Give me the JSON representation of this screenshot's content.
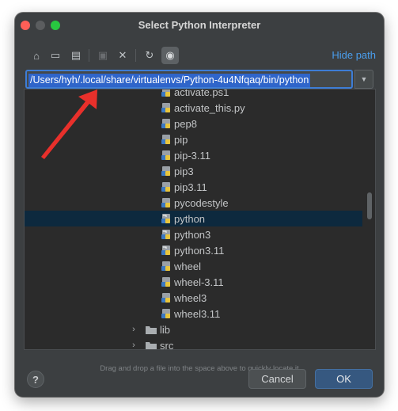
{
  "window": {
    "title": "Select Python Interpreter",
    "traffic_colors": {
      "close": "#ff5f57",
      "minimize": "#5b5d5f",
      "maximize": "#28c840"
    }
  },
  "toolbar": {
    "buttons": [
      {
        "icon": "home-icon",
        "glyph": "⌂"
      },
      {
        "icon": "desktop-icon",
        "glyph": "▭"
      },
      {
        "icon": "project-folder-icon",
        "glyph": "▤"
      },
      {
        "icon": "new-folder-icon",
        "glyph": "▣"
      },
      {
        "icon": "delete-icon",
        "glyph": "✕"
      },
      {
        "icon": "refresh-icon",
        "glyph": "↻"
      },
      {
        "icon": "show-hidden-files-icon",
        "glyph": "◉"
      }
    ],
    "hide_path_label": "Hide path"
  },
  "path_field": {
    "value": "/Users/hyh/.local/share/virtualenvs/Python-4u4Nfqaq/bin/python"
  },
  "tree": {
    "python_files": [
      "activate.ps1",
      "activate_this.py",
      "pep8",
      "pip",
      "pip-3.11",
      "pip3",
      "pip3.11",
      "pycodestyle",
      "python",
      "python3",
      "python3.11",
      "wheel",
      "wheel-3.11",
      "wheel3",
      "wheel3.11"
    ],
    "selected": "python",
    "folders": [
      "lib",
      "src"
    ]
  },
  "hint_text": "Drag and drop a file into the space above to quickly locate it",
  "footer": {
    "help_label": "?",
    "cancel_label": "Cancel",
    "ok_label": "OK"
  },
  "colors": {
    "accent": "#3d7dd6",
    "selection": "#0d293e",
    "annotation_arrow": "#e8302b"
  }
}
